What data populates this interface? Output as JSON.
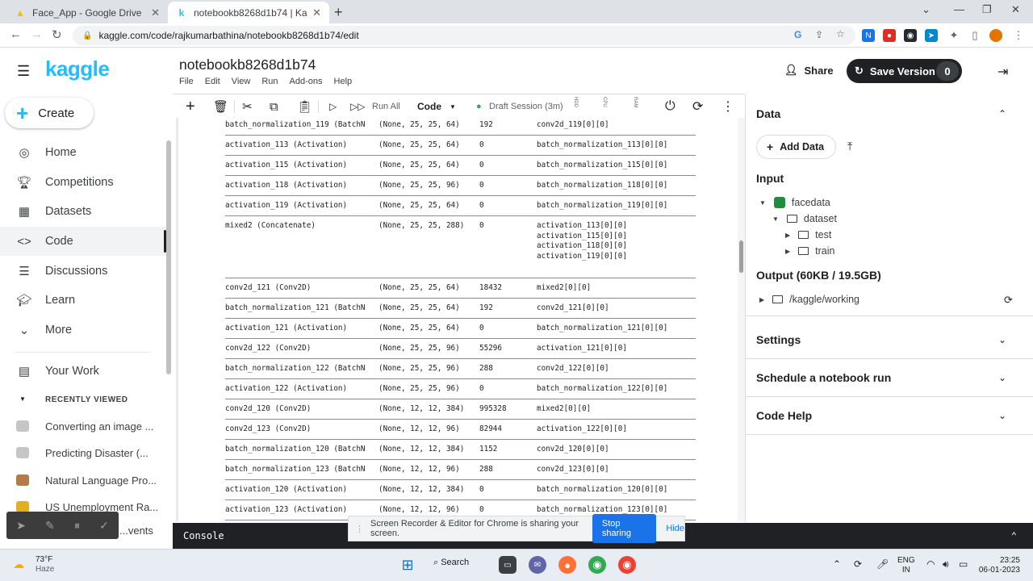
{
  "browser": {
    "tabs": [
      {
        "title": "Face_App - Google Drive",
        "active": false
      },
      {
        "title": "notebookb8268d1b74 | Kaggle",
        "active": true
      }
    ],
    "url": "kaggle.com/code/rajkumarbathina/notebookb8268d1b74/edit"
  },
  "sidebar": {
    "logo": "kaggle",
    "create_label": "Create",
    "items": [
      {
        "label": "Home",
        "icon": "compass-icon"
      },
      {
        "label": "Competitions",
        "icon": "trophy-icon"
      },
      {
        "label": "Datasets",
        "icon": "table-icon"
      },
      {
        "label": "Code",
        "icon": "code-icon",
        "selected": true
      },
      {
        "label": "Discussions",
        "icon": "discussions-icon"
      },
      {
        "label": "Learn",
        "icon": "learn-icon"
      },
      {
        "label": "More",
        "icon": "chevron-down-icon"
      }
    ],
    "your_work": "Your Work",
    "recently_viewed_heading": "RECENTLY VIEWED",
    "recent": [
      "Converting an image ...",
      "Predicting Disaster (...",
      "Natural Language Pro...",
      "US Unemployment Ra...",
      "...vents"
    ]
  },
  "notebook": {
    "title": "notebookb8268d1b74",
    "menu": [
      "File",
      "Edit",
      "View",
      "Run",
      "Add-ons",
      "Help"
    ],
    "share_label": "Share",
    "save_label": "Save Version",
    "save_count": "0",
    "toolbar": {
      "run_all": "Run All",
      "cell_type": "Code",
      "session": "Draft Session (3m)",
      "hdd": "HDD",
      "cpu": "CPU",
      "ram": "RAM"
    }
  },
  "model_summary": [
    {
      "layer": "batch_normalization_119 (BatchN",
      "shape": "(None, 25, 25, 64)",
      "params": "192",
      "connected": [
        "conv2d_119[0][0]"
      ]
    },
    {
      "layer": "activation_113 (Activation)",
      "shape": "(None, 25, 25, 64)",
      "params": "0",
      "connected": [
        "batch_normalization_113[0][0]"
      ]
    },
    {
      "layer": "activation_115 (Activation)",
      "shape": "(None, 25, 25, 64)",
      "params": "0",
      "connected": [
        "batch_normalization_115[0][0]"
      ]
    },
    {
      "layer": "activation_118 (Activation)",
      "shape": "(None, 25, 25, 96)",
      "params": "0",
      "connected": [
        "batch_normalization_118[0][0]"
      ]
    },
    {
      "layer": "activation_119 (Activation)",
      "shape": "(None, 25, 25, 64)",
      "params": "0",
      "connected": [
        "batch_normalization_119[0][0]"
      ]
    },
    {
      "layer": "mixed2 (Concatenate)",
      "shape": "(None, 25, 25, 288)",
      "params": "0",
      "connected": [
        "activation_113[0][0]",
        "activation_115[0][0]",
        "activation_118[0][0]",
        "activation_119[0][0]"
      ]
    },
    {
      "layer": "conv2d_121 (Conv2D)",
      "shape": "(None, 25, 25, 64)",
      "params": "18432",
      "connected": [
        "mixed2[0][0]"
      ]
    },
    {
      "layer": "batch_normalization_121 (BatchN",
      "shape": "(None, 25, 25, 64)",
      "params": "192",
      "connected": [
        "conv2d_121[0][0]"
      ]
    },
    {
      "layer": "activation_121 (Activation)",
      "shape": "(None, 25, 25, 64)",
      "params": "0",
      "connected": [
        "batch_normalization_121[0][0]"
      ]
    },
    {
      "layer": "conv2d_122 (Conv2D)",
      "shape": "(None, 25, 25, 96)",
      "params": "55296",
      "connected": [
        "activation_121[0][0]"
      ]
    },
    {
      "layer": "batch_normalization_122 (BatchN",
      "shape": "(None, 25, 25, 96)",
      "params": "288",
      "connected": [
        "conv2d_122[0][0]"
      ]
    },
    {
      "layer": "activation_122 (Activation)",
      "shape": "(None, 25, 25, 96)",
      "params": "0",
      "connected": [
        "batch_normalization_122[0][0]"
      ]
    },
    {
      "layer": "conv2d_120 (Conv2D)",
      "shape": "(None, 12, 12, 384)",
      "params": "995328",
      "connected": [
        "mixed2[0][0]"
      ]
    },
    {
      "layer": "conv2d_123 (Conv2D)",
      "shape": "(None, 12, 12, 96)",
      "params": "82944",
      "connected": [
        "activation_122[0][0]"
      ]
    },
    {
      "layer": "batch_normalization_120 (BatchN",
      "shape": "(None, 12, 12, 384)",
      "params": "1152",
      "connected": [
        "conv2d_120[0][0]"
      ]
    },
    {
      "layer": "batch_normalization_123 (BatchN",
      "shape": "(None, 12, 12, 96)",
      "params": "288",
      "connected": [
        "conv2d_123[0][0]"
      ]
    },
    {
      "layer": "activation_120 (Activation)",
      "shape": "(None, 12, 12, 384)",
      "params": "0",
      "connected": [
        "batch_normalization_120[0][0]"
      ]
    },
    {
      "layer": "activation_123 (Activation)",
      "shape": "(None, 12, 12, 96)",
      "params": "0",
      "connected": [
        "batch_normalization_123[0][0]"
      ]
    }
  ],
  "right_panel": {
    "data_heading": "Data",
    "add_data": "Add Data",
    "input_heading": "Input",
    "tree": [
      {
        "label": "facedata",
        "level": 0
      },
      {
        "label": "dataset",
        "level": 1
      },
      {
        "label": "test",
        "level": 2
      },
      {
        "label": "train",
        "level": 2
      }
    ],
    "output_heading": "Output (60KB / 19.5GB)",
    "output_path": "/kaggle/working",
    "sections": [
      "Settings",
      "Schedule a notebook run",
      "Code Help"
    ]
  },
  "console_label": "Console",
  "screen_share": {
    "message": "Screen Recorder & Editor for Chrome is sharing your screen.",
    "stop": "Stop sharing",
    "hide": "Hide"
  },
  "taskbar": {
    "temp": "73°F",
    "weather": "Haze",
    "search": "Search",
    "lang1": "ENG",
    "lang2": "IN",
    "time": "23:25",
    "date": "06-01-2023"
  },
  "colors": {
    "kaggle_blue": "#20beff",
    "save_button": "#202124",
    "console_bg": "#202124",
    "stop_sharing": "#1a73e8"
  }
}
